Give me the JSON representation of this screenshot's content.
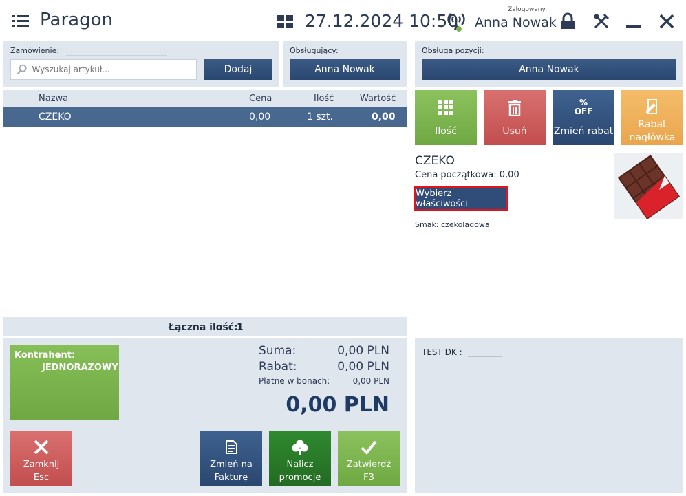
{
  "header": {
    "title": "Paragon",
    "datetime": "27.12.2024 10:50",
    "logged_label": "Zalogowany:",
    "user": "Anna Nowak",
    "icons": [
      "menu-icon",
      "grid-icon",
      "signal-icon",
      "lock-icon",
      "tools-icon",
      "minimize-icon",
      "close-icon"
    ]
  },
  "order": {
    "label": "Zamówienie:",
    "search_placeholder": "Wyszukaj artykuł...",
    "add_button": "Dodaj"
  },
  "served_by": {
    "label": "Obsługujący:",
    "value": "Anna Nowak"
  },
  "item_service": {
    "label": "Obsługa pozycji:",
    "value": "Anna Nowak"
  },
  "table": {
    "columns": [
      "Nazwa",
      "Cena",
      "Ilość",
      "Wartość"
    ],
    "rows": [
      {
        "name": "CZEKO",
        "price": "0,00",
        "qty": "1 szt.",
        "value": "0,00"
      }
    ],
    "total_label": "Łączna ilość:",
    "total_value": "1"
  },
  "actions": {
    "qty": "Ilość",
    "delete": "Usuń",
    "change_discount": "Zmień rabat",
    "discount_off": "OFF",
    "header_discount_1": "Rabat",
    "header_discount_2": "nagłówka"
  },
  "item_detail": {
    "name": "CZEKO",
    "initial_price": "Cena początkowa: 0,00",
    "choose_props": "Wybierz właściwości",
    "flavor": "Smak: czekoladowa"
  },
  "customer": {
    "label": "Kontrahent:",
    "value": "JEDNORAZOWY"
  },
  "summary": {
    "sum_label": "Suma:",
    "sum_value": "0,00 PLN",
    "discount_label": "Rabat:",
    "discount_value": "0,00 PLN",
    "vouchers_label": "Płatne w bonach:",
    "vouchers_value": "0,00 PLN",
    "total": "0,00 PLN"
  },
  "footer_buttons": {
    "close_1": "Zamknij",
    "close_2": "Esc",
    "invoice_1": "Zmień na",
    "invoice_2": "Fakturę",
    "promo_1": "Nalicz",
    "promo_2": "promocje",
    "confirm_1": "Zatwierdź",
    "confirm_2": "F3"
  },
  "test_dk": {
    "label": "TEST DK :"
  },
  "colors": {
    "navy": "#2a4770",
    "green": "#7bb24f",
    "red": "#cf5a5a",
    "orange": "#eaa54d",
    "dark_green": "#2e7d2e"
  }
}
